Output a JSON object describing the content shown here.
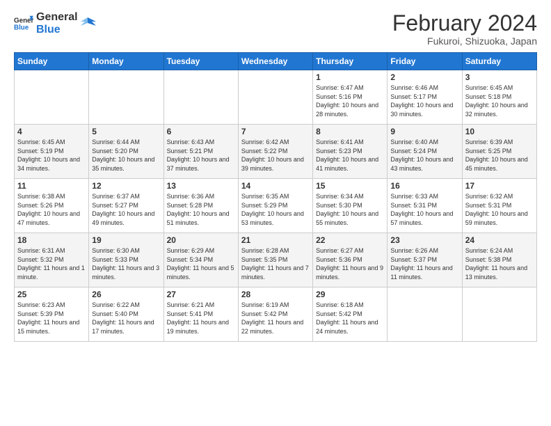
{
  "header": {
    "logo_general": "General",
    "logo_blue": "Blue",
    "month_year": "February 2024",
    "location": "Fukuroi, Shizuoka, Japan"
  },
  "days": [
    "Sunday",
    "Monday",
    "Tuesday",
    "Wednesday",
    "Thursday",
    "Friday",
    "Saturday"
  ],
  "weeks": [
    [
      {
        "date": "",
        "sunrise": "",
        "sunset": "",
        "daylight": ""
      },
      {
        "date": "",
        "sunrise": "",
        "sunset": "",
        "daylight": ""
      },
      {
        "date": "",
        "sunrise": "",
        "sunset": "",
        "daylight": ""
      },
      {
        "date": "",
        "sunrise": "",
        "sunset": "",
        "daylight": ""
      },
      {
        "date": "1",
        "sunrise": "Sunrise: 6:47 AM",
        "sunset": "Sunset: 5:16 PM",
        "daylight": "Daylight: 10 hours and 28 minutes."
      },
      {
        "date": "2",
        "sunrise": "Sunrise: 6:46 AM",
        "sunset": "Sunset: 5:17 PM",
        "daylight": "Daylight: 10 hours and 30 minutes."
      },
      {
        "date": "3",
        "sunrise": "Sunrise: 6:45 AM",
        "sunset": "Sunset: 5:18 PM",
        "daylight": "Daylight: 10 hours and 32 minutes."
      }
    ],
    [
      {
        "date": "4",
        "sunrise": "Sunrise: 6:45 AM",
        "sunset": "Sunset: 5:19 PM",
        "daylight": "Daylight: 10 hours and 34 minutes."
      },
      {
        "date": "5",
        "sunrise": "Sunrise: 6:44 AM",
        "sunset": "Sunset: 5:20 PM",
        "daylight": "Daylight: 10 hours and 35 minutes."
      },
      {
        "date": "6",
        "sunrise": "Sunrise: 6:43 AM",
        "sunset": "Sunset: 5:21 PM",
        "daylight": "Daylight: 10 hours and 37 minutes."
      },
      {
        "date": "7",
        "sunrise": "Sunrise: 6:42 AM",
        "sunset": "Sunset: 5:22 PM",
        "daylight": "Daylight: 10 hours and 39 minutes."
      },
      {
        "date": "8",
        "sunrise": "Sunrise: 6:41 AM",
        "sunset": "Sunset: 5:23 PM",
        "daylight": "Daylight: 10 hours and 41 minutes."
      },
      {
        "date": "9",
        "sunrise": "Sunrise: 6:40 AM",
        "sunset": "Sunset: 5:24 PM",
        "daylight": "Daylight: 10 hours and 43 minutes."
      },
      {
        "date": "10",
        "sunrise": "Sunrise: 6:39 AM",
        "sunset": "Sunset: 5:25 PM",
        "daylight": "Daylight: 10 hours and 45 minutes."
      }
    ],
    [
      {
        "date": "11",
        "sunrise": "Sunrise: 6:38 AM",
        "sunset": "Sunset: 5:26 PM",
        "daylight": "Daylight: 10 hours and 47 minutes."
      },
      {
        "date": "12",
        "sunrise": "Sunrise: 6:37 AM",
        "sunset": "Sunset: 5:27 PM",
        "daylight": "Daylight: 10 hours and 49 minutes."
      },
      {
        "date": "13",
        "sunrise": "Sunrise: 6:36 AM",
        "sunset": "Sunset: 5:28 PM",
        "daylight": "Daylight: 10 hours and 51 minutes."
      },
      {
        "date": "14",
        "sunrise": "Sunrise: 6:35 AM",
        "sunset": "Sunset: 5:29 PM",
        "daylight": "Daylight: 10 hours and 53 minutes."
      },
      {
        "date": "15",
        "sunrise": "Sunrise: 6:34 AM",
        "sunset": "Sunset: 5:30 PM",
        "daylight": "Daylight: 10 hours and 55 minutes."
      },
      {
        "date": "16",
        "sunrise": "Sunrise: 6:33 AM",
        "sunset": "Sunset: 5:31 PM",
        "daylight": "Daylight: 10 hours and 57 minutes."
      },
      {
        "date": "17",
        "sunrise": "Sunrise: 6:32 AM",
        "sunset": "Sunset: 5:31 PM",
        "daylight": "Daylight: 10 hours and 59 minutes."
      }
    ],
    [
      {
        "date": "18",
        "sunrise": "Sunrise: 6:31 AM",
        "sunset": "Sunset: 5:32 PM",
        "daylight": "Daylight: 11 hours and 1 minute."
      },
      {
        "date": "19",
        "sunrise": "Sunrise: 6:30 AM",
        "sunset": "Sunset: 5:33 PM",
        "daylight": "Daylight: 11 hours and 3 minutes."
      },
      {
        "date": "20",
        "sunrise": "Sunrise: 6:29 AM",
        "sunset": "Sunset: 5:34 PM",
        "daylight": "Daylight: 11 hours and 5 minutes."
      },
      {
        "date": "21",
        "sunrise": "Sunrise: 6:28 AM",
        "sunset": "Sunset: 5:35 PM",
        "daylight": "Daylight: 11 hours and 7 minutes."
      },
      {
        "date": "22",
        "sunrise": "Sunrise: 6:27 AM",
        "sunset": "Sunset: 5:36 PM",
        "daylight": "Daylight: 11 hours and 9 minutes."
      },
      {
        "date": "23",
        "sunrise": "Sunrise: 6:26 AM",
        "sunset": "Sunset: 5:37 PM",
        "daylight": "Daylight: 11 hours and 11 minutes."
      },
      {
        "date": "24",
        "sunrise": "Sunrise: 6:24 AM",
        "sunset": "Sunset: 5:38 PM",
        "daylight": "Daylight: 11 hours and 13 minutes."
      }
    ],
    [
      {
        "date": "25",
        "sunrise": "Sunrise: 6:23 AM",
        "sunset": "Sunset: 5:39 PM",
        "daylight": "Daylight: 11 hours and 15 minutes."
      },
      {
        "date": "26",
        "sunrise": "Sunrise: 6:22 AM",
        "sunset": "Sunset: 5:40 PM",
        "daylight": "Daylight: 11 hours and 17 minutes."
      },
      {
        "date": "27",
        "sunrise": "Sunrise: 6:21 AM",
        "sunset": "Sunset: 5:41 PM",
        "daylight": "Daylight: 11 hours and 19 minutes."
      },
      {
        "date": "28",
        "sunrise": "Sunrise: 6:19 AM",
        "sunset": "Sunset: 5:42 PM",
        "daylight": "Daylight: 11 hours and 22 minutes."
      },
      {
        "date": "29",
        "sunrise": "Sunrise: 6:18 AM",
        "sunset": "Sunset: 5:42 PM",
        "daylight": "Daylight: 11 hours and 24 minutes."
      },
      {
        "date": "",
        "sunrise": "",
        "sunset": "",
        "daylight": ""
      },
      {
        "date": "",
        "sunrise": "",
        "sunset": "",
        "daylight": ""
      }
    ]
  ]
}
